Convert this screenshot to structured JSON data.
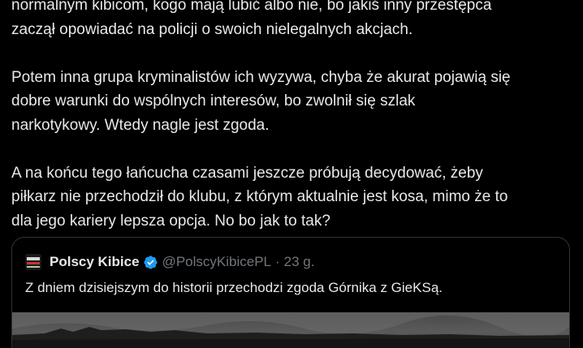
{
  "tweet": {
    "paragraph1": {
      "line1": "normalnym kibicom, kogo mają lubić albo nie, bo jakiś inny przestępca",
      "line2": "zaczął opowiadać na policji o swoich nielegalnych akcjach."
    },
    "paragraph2": {
      "line1": "Potem inna grupa kryminalistów ich wyzywa, chyba że akurat pojawią się",
      "line2": "dobre warunki do wspólnych interesów, bo zwolnił się szlak",
      "line3": "narkotykowy. Wtedy nagle jest zgoda."
    },
    "paragraph3": {
      "line1": "A na końcu tego łańcucha czasami jeszcze próbują decydować, żeby",
      "line2": "piłkarz nie przechodził do klubu, z którym aktualnie jest kosa, mimo że to",
      "line3": "dla jego kariery lepsza opcja. No bo jak to tak?"
    }
  },
  "quote": {
    "display_name": "Polscy Kibice",
    "handle": "@PolscyKibicePL",
    "separator": "·",
    "time": "23 g.",
    "text": "Z dniem dzisiejszym do historii przechodzi zgoda Górnika z GieKSą.",
    "avatar_icon": "polscy-kibice-logo",
    "verified_icon": "verified-badge-icon",
    "verified_color": "#1d9bf0"
  },
  "colors": {
    "background": "#000000",
    "text": "#e7e9ea",
    "secondary": "#71767b",
    "border": "#2f3336"
  }
}
